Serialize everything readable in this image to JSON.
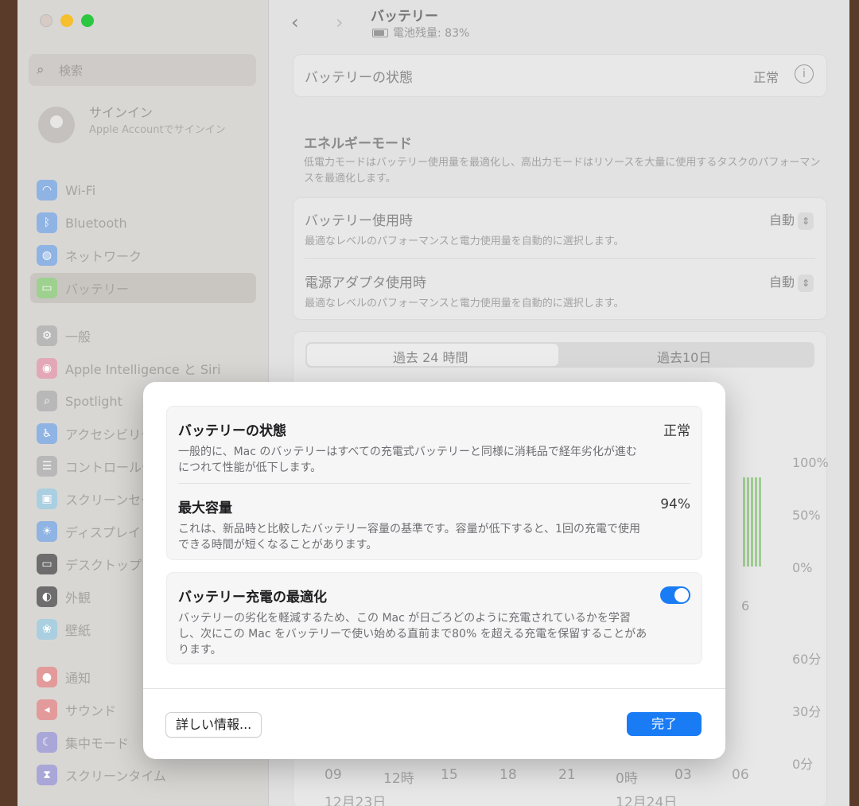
{
  "window": {
    "title": "バッテリー",
    "subtitle": "電池残量: 83%"
  },
  "sidebar": {
    "search_placeholder": "検索",
    "account": {
      "title": "サインイン",
      "subtitle": "Apple Accountでサインイン"
    },
    "items": [
      {
        "label": "Wi-Fi",
        "icon": "wifi-icon",
        "color": "#8fb3e3"
      },
      {
        "label": "Bluetooth",
        "icon": "bluetooth-icon",
        "color": "#8fb3e3"
      },
      {
        "label": "ネットワーク",
        "icon": "globe-icon",
        "color": "#8fb3e3"
      },
      {
        "label": "バッテリー",
        "icon": "battery-icon",
        "color": "#9ed08f"
      },
      {
        "label": "一般",
        "icon": "gear-icon",
        "color": "#b8b8b8"
      },
      {
        "label": "Apple Intelligence と Siri",
        "icon": "siri-icon",
        "color": "#e3a8b8"
      },
      {
        "label": "Spotlight",
        "icon": "spotlight-icon",
        "color": "#b8b8b8"
      },
      {
        "label": "アクセシビリティ",
        "icon": "accessibility-icon",
        "color": "#8fb3e3"
      },
      {
        "label": "コントロールセンター",
        "icon": "control-center-icon",
        "color": "#b8b8b8"
      },
      {
        "label": "スクリーンセーバ",
        "icon": "screensaver-icon",
        "color": "#a9cfe1"
      },
      {
        "label": "ディスプレイ",
        "icon": "display-icon",
        "color": "#8fb3e3"
      },
      {
        "label": "デスクトップとDock",
        "icon": "desktop-icon",
        "color": "#6d6d6d"
      },
      {
        "label": "外観",
        "icon": "appearance-icon",
        "color": "#6d6d6d"
      },
      {
        "label": "壁紙",
        "icon": "wallpaper-icon",
        "color": "#a9cfe1"
      },
      {
        "label": "通知",
        "icon": "notifications-icon",
        "color": "#e39a9a"
      },
      {
        "label": "サウンド",
        "icon": "sound-icon",
        "color": "#e39a9a"
      },
      {
        "label": "集中モード",
        "icon": "focus-icon",
        "color": "#a9a6d8"
      },
      {
        "label": "スクリーンタイム",
        "icon": "hourglass-icon",
        "color": "#a9a6d8"
      }
    ]
  },
  "main": {
    "health_row": {
      "label": "バッテリーの状態",
      "value": "正常"
    },
    "energy": {
      "title": "エネルギーモード",
      "desc": "低電力モードはバッテリー使用量を最適化し、高出力モードはリソースを大量に使用するタスクのパフォーマンスを最適化します。"
    },
    "on_battery": {
      "label": "バッテリー使用時",
      "desc": "最適なレベルのパフォーマンスと電力使用量を自動的に選択します。",
      "value": "自動"
    },
    "on_adapter": {
      "label": "電源アダプタ使用時",
      "desc": "最適なレベルのパフォーマンスと電力使用量を自動的に選択します。",
      "value": "自動"
    },
    "tabs": [
      "過去 24 時間",
      "過去10日"
    ],
    "chart_axis": [
      "100%",
      "50%",
      "0%",
      "60分",
      "30分",
      "0分"
    ],
    "time_labels": [
      "09",
      "12時",
      "15",
      "18",
      "21",
      "0時",
      "03",
      "06"
    ],
    "date_labels": [
      "12月23日",
      "12月24日"
    ],
    "partial_label": "6"
  },
  "dialog": {
    "health": {
      "title": "バッテリーの状態",
      "value": "正常",
      "desc": "一般的に、Mac のバッテリーはすべての充電式バッテリーと同様に消耗品で経年劣化が進むにつれて性能が低下します。"
    },
    "capacity": {
      "title": "最大容量",
      "value": "94%",
      "desc": "これは、新品時と比較したバッテリー容量の基準です。容量が低下すると、1回の充電で使用できる時間が短くなることがあります。"
    },
    "optimize": {
      "title": "バッテリー充電の最適化",
      "enabled": true,
      "desc": "バッテリーの劣化を軽減するため、この Mac が日ごろどのように充電されているかを学習し、次にこの Mac をバッテリーで使い始める直前まで80% を超える充電を保留することがあります。"
    },
    "more_button": "詳しい情報...",
    "done_button": "完了"
  },
  "colors": {
    "accent": "#1a7cf5"
  }
}
